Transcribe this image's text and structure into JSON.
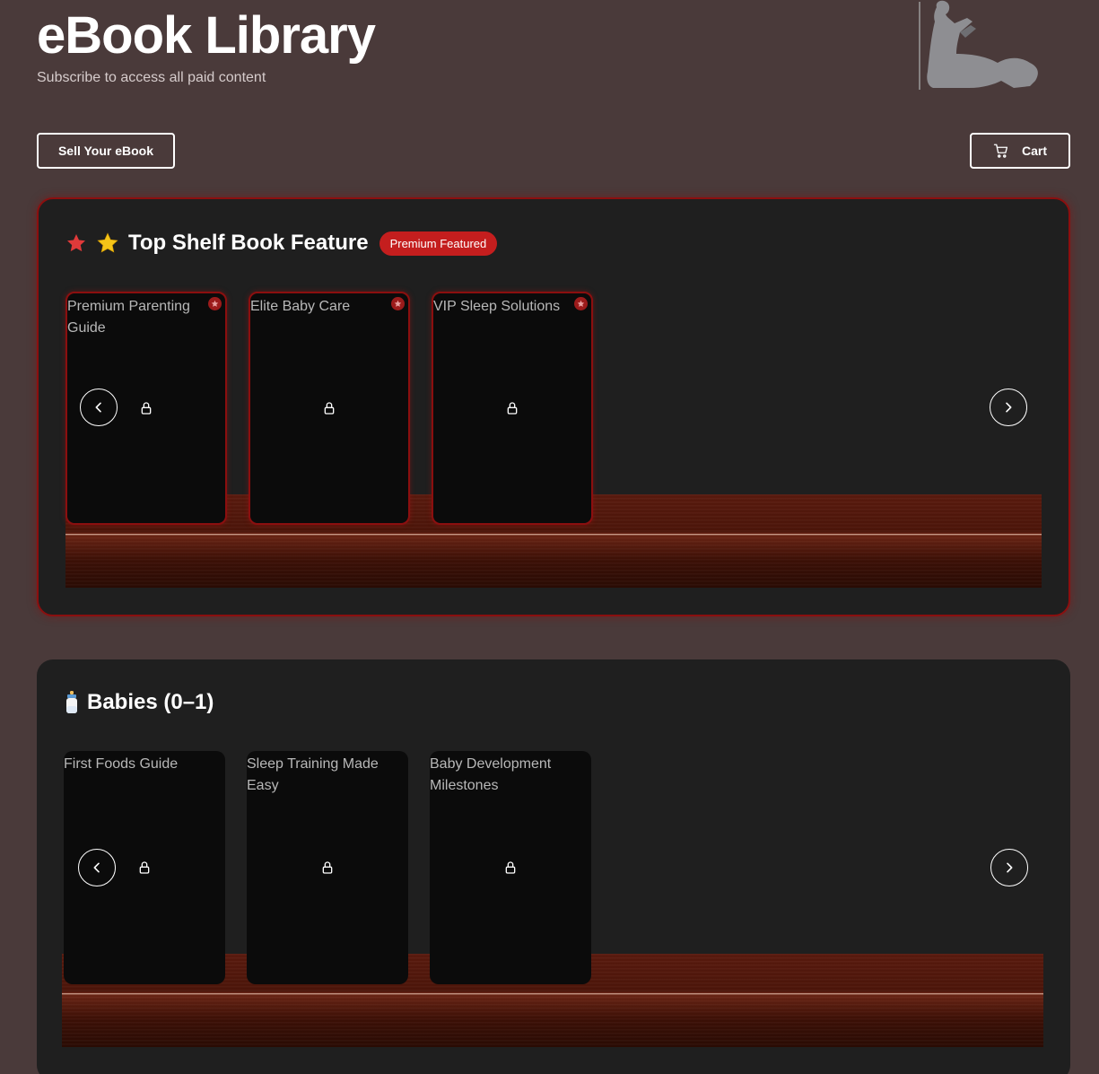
{
  "header": {
    "title": "eBook Library",
    "subtitle": "Subscribe to access all paid content"
  },
  "toolbar": {
    "sell_label": "Sell Your eBook",
    "cart_label": "Cart"
  },
  "sections": [
    {
      "title": "Top Shelf Book Feature",
      "badge": "Premium Featured",
      "title_emoji": "⭐",
      "books": [
        {
          "title": "Premium Parenting Guide",
          "locked": true,
          "featured": true
        },
        {
          "title": "Elite Baby Care",
          "locked": true,
          "featured": true
        },
        {
          "title": "VIP Sleep Solutions",
          "locked": true,
          "featured": true
        }
      ]
    },
    {
      "title": "Babies (0–1)",
      "title_emoji": "🍼",
      "books": [
        {
          "title": "First Foods Guide",
          "locked": true
        },
        {
          "title": "Sleep Training Made Easy",
          "locked": true
        },
        {
          "title": "Baby Development Milestones",
          "locked": true
        }
      ]
    }
  ],
  "colors": {
    "background": "#4a3a3a",
    "panel": "#1f1f1f",
    "accent": "#c41e1e",
    "featured_border": "#8b0f0f",
    "star_yellow": "#f5c518",
    "star_red": "#e03a3a"
  },
  "icons": [
    "cart-icon",
    "star-icon",
    "lock-icon",
    "chevron-left-icon",
    "chevron-right-icon",
    "baby-bottle-icon",
    "reader-illustration"
  ]
}
